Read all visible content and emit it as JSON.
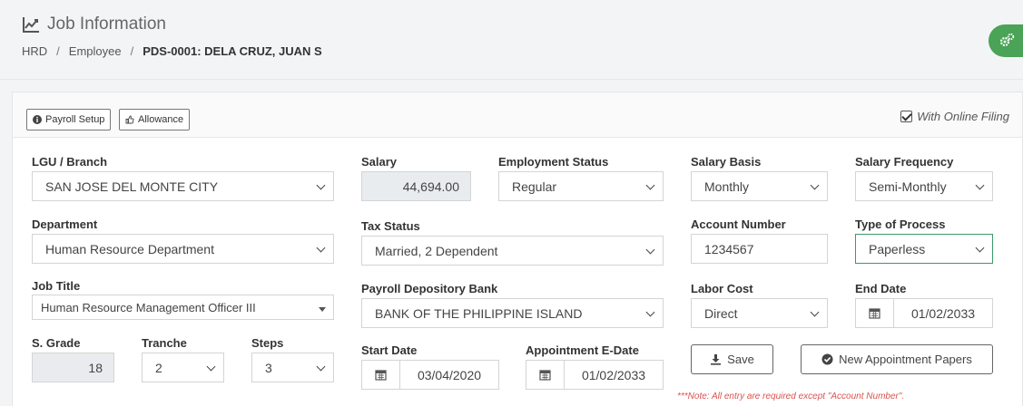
{
  "header": {
    "title": "Job Information",
    "breadcrumb": {
      "item1": "HRD",
      "sep": "/",
      "item2": "Employee",
      "current": "PDS-0001: DELA CRUZ, JUAN S"
    }
  },
  "toolbar": {
    "payroll_setup": "Payroll Setup",
    "allowance": "Allowance",
    "online_filing": "With Online Filing",
    "online_filing_checked": true
  },
  "form": {
    "lgu_branch": {
      "label": "LGU / Branch",
      "value": "SAN JOSE DEL MONTE CITY"
    },
    "department": {
      "label": "Department",
      "value": "Human Resource Department"
    },
    "job_title": {
      "label": "Job Title",
      "value": "Human Resource Management Officer III"
    },
    "s_grade": {
      "label": "S. Grade",
      "value": "18"
    },
    "tranche": {
      "label": "Tranche",
      "value": "2"
    },
    "steps": {
      "label": "Steps",
      "value": "3"
    },
    "salary": {
      "label": "Salary",
      "value": "44,694.00"
    },
    "employment_status": {
      "label": "Employment Status",
      "value": "Regular"
    },
    "tax_status": {
      "label": "Tax Status",
      "value": "Married, 2 Dependent"
    },
    "payroll_bank": {
      "label": "Payroll Depository Bank",
      "value": "BANK OF THE PHILIPPINE ISLAND"
    },
    "start_date": {
      "label": "Start Date",
      "value": "03/04/2020"
    },
    "appointment_edate": {
      "label": "Appointment E-Date",
      "value": "01/02/2033"
    },
    "salary_basis": {
      "label": "Salary Basis",
      "value": "Monthly"
    },
    "salary_frequency": {
      "label": "Salary Frequency",
      "value": "Semi-Monthly"
    },
    "account_number": {
      "label": "Account Number",
      "value": "1234567"
    },
    "type_of_process": {
      "label": "Type of Process",
      "value": "Paperless"
    },
    "labor_cost": {
      "label": "Labor Cost",
      "value": "Direct"
    },
    "end_date": {
      "label": "End Date",
      "value": "01/02/2033"
    }
  },
  "actions": {
    "save": "Save",
    "new_appointment": "New Appointment Papers"
  },
  "note": "***Note: All entry are required except \"Account Number\".",
  "colors": {
    "accent_green": "#4aa356",
    "note_red": "#d9534f",
    "readonly_bg": "#e9ecef"
  }
}
